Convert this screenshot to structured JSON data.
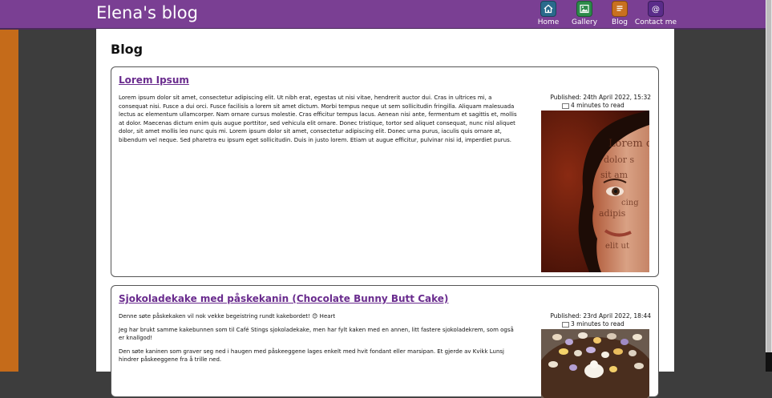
{
  "header": {
    "site_title": "Elena's blog",
    "nav": [
      {
        "label": "Home",
        "icon": "home-icon",
        "color": "#2a6a8c"
      },
      {
        "label": "Gallery",
        "icon": "image-icon",
        "color": "#2c8a4a"
      },
      {
        "label": "Blog",
        "icon": "document-icon",
        "color": "#c9701f"
      },
      {
        "label": "Contact me",
        "icon": "at-icon",
        "color": "#5a2c8a"
      }
    ]
  },
  "main": {
    "heading": "Blog",
    "posts": [
      {
        "title": "Lorem Ipsum",
        "paragraphs": [
          "Lorem ipsum dolor sit amet, consectetur adipiscing elit. Ut nibh erat, egestas ut nisi vitae, hendrerit auctor dui. Cras in ultrices mi, a consequat nisi. Fusce a dui orci. Fusce facilisis a lorem sit amet dictum. Morbi tempus neque ut sem sollicitudin fringilla. Aliquam malesuada lectus ac elementum ullamcorper. Nam ornare cursus molestie. Cras efficitur tempus lacus. Aenean nisi ante, fermentum et sagittis et, mollis at dolor. Maecenas dictum enim quis augue porttitor, sed vehicula elit ornare. Donec tristique, tortor sed aliquet consequat, nunc nisl aliquet dolor, sit amet mollis leo nunc quis mi. Lorem ipsum dolor sit amet, consectetur adipiscing elit. Donec urna purus, iaculis quis ornare at, bibendum vel neque. Sed pharetra eu ipsum eget sollicitudin. Duis in justo lorem. Etiam ut augue efficitur, pulvinar nisi id, imperdiet purus."
        ],
        "published": "Published: 24th April 2022, 15:32",
        "read_time": "4 minutes to read",
        "image_lettering": "Lorem dolor sit adipiscing elit"
      },
      {
        "title": "Sjokoladekake med påskekanin (Chocolate Bunny Butt Cake)",
        "paragraphs": [
          "Denne søte påskekaken vil nok vekke begeistring rundt kakebordet! 😊 Heart",
          "Jeg har brukt samme kakebunnen som til Café Stings sjokoladekake, men har fylt kaken med en annen, litt fastere sjokoladekrem, som også er knallgod!",
          "Den søte kaninen som graver seg ned i haugen med påskeeggene lages enkelt med hvit fondant eller marsipan. Et gjerde av Kvikk Lunsj hindrer påskeeggene fra å trille ned."
        ],
        "published": "Published: 23rd April 2022, 18:44",
        "read_time": "3 minutes to read"
      }
    ]
  }
}
